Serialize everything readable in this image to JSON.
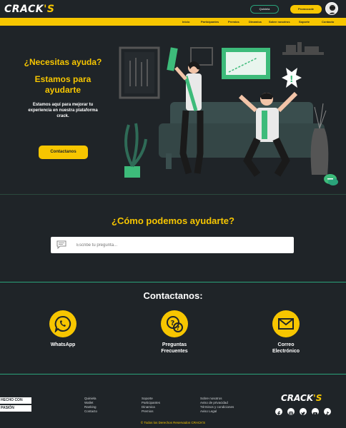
{
  "header": {
    "logo_main": "CRACK",
    "logo_accent": "'S",
    "quiniela_label": "Quiniela",
    "promo_label": "Promocode"
  },
  "nav": {
    "items": [
      "Inicio",
      "Participantes",
      "Premios",
      "Dinamica",
      "Sobre nosotros",
      "Soporte",
      "Contacto"
    ]
  },
  "hero": {
    "question": "¿Necesitas ayuda?",
    "title": "Estamos para ayudarte",
    "description": "Estamos aquí para mejorar tu experiencia en nuestra plataforma crack.",
    "cta_label": "Contactanos"
  },
  "help": {
    "title": "¿Cómo podemos ayudarte?",
    "search_placeholder": "Escribe tu pregunta..."
  },
  "contact": {
    "title": "Contactanos:",
    "items": [
      {
        "label_1": "WhatsApp",
        "label_2": "",
        "icon": "whatsapp-icon"
      },
      {
        "label_1": "Preguntas",
        "label_2": "Frecuentes",
        "icon": "faq-icon"
      },
      {
        "label_1": "Correo",
        "label_2": "Electrónico",
        "icon": "mail-icon"
      }
    ]
  },
  "footer": {
    "badge_1": "HECHO CON",
    "badge_2": "PASIÓN",
    "col1": [
      "Quiniela",
      "Wallet",
      "Ranking",
      "Contacto"
    ],
    "col2": [
      "Soporte",
      "Participantes",
      "Dinamica",
      "Premios"
    ],
    "col3": [
      "Sobre nosotros",
      "Aviso de privacidad",
      "Términos y condiciones",
      "Aviso Legal"
    ],
    "logo_main": "CRACK",
    "logo_accent": "'S",
    "social": [
      "facebook-icon",
      "instagram-icon",
      "twitter-icon",
      "youtube-icon",
      "tiktok-icon"
    ],
    "copyright": "© Todos los Derechos Reservados CRACK'S"
  },
  "colors": {
    "background": "#1f2428",
    "accent": "#f7c600",
    "green": "#2aa37a"
  }
}
